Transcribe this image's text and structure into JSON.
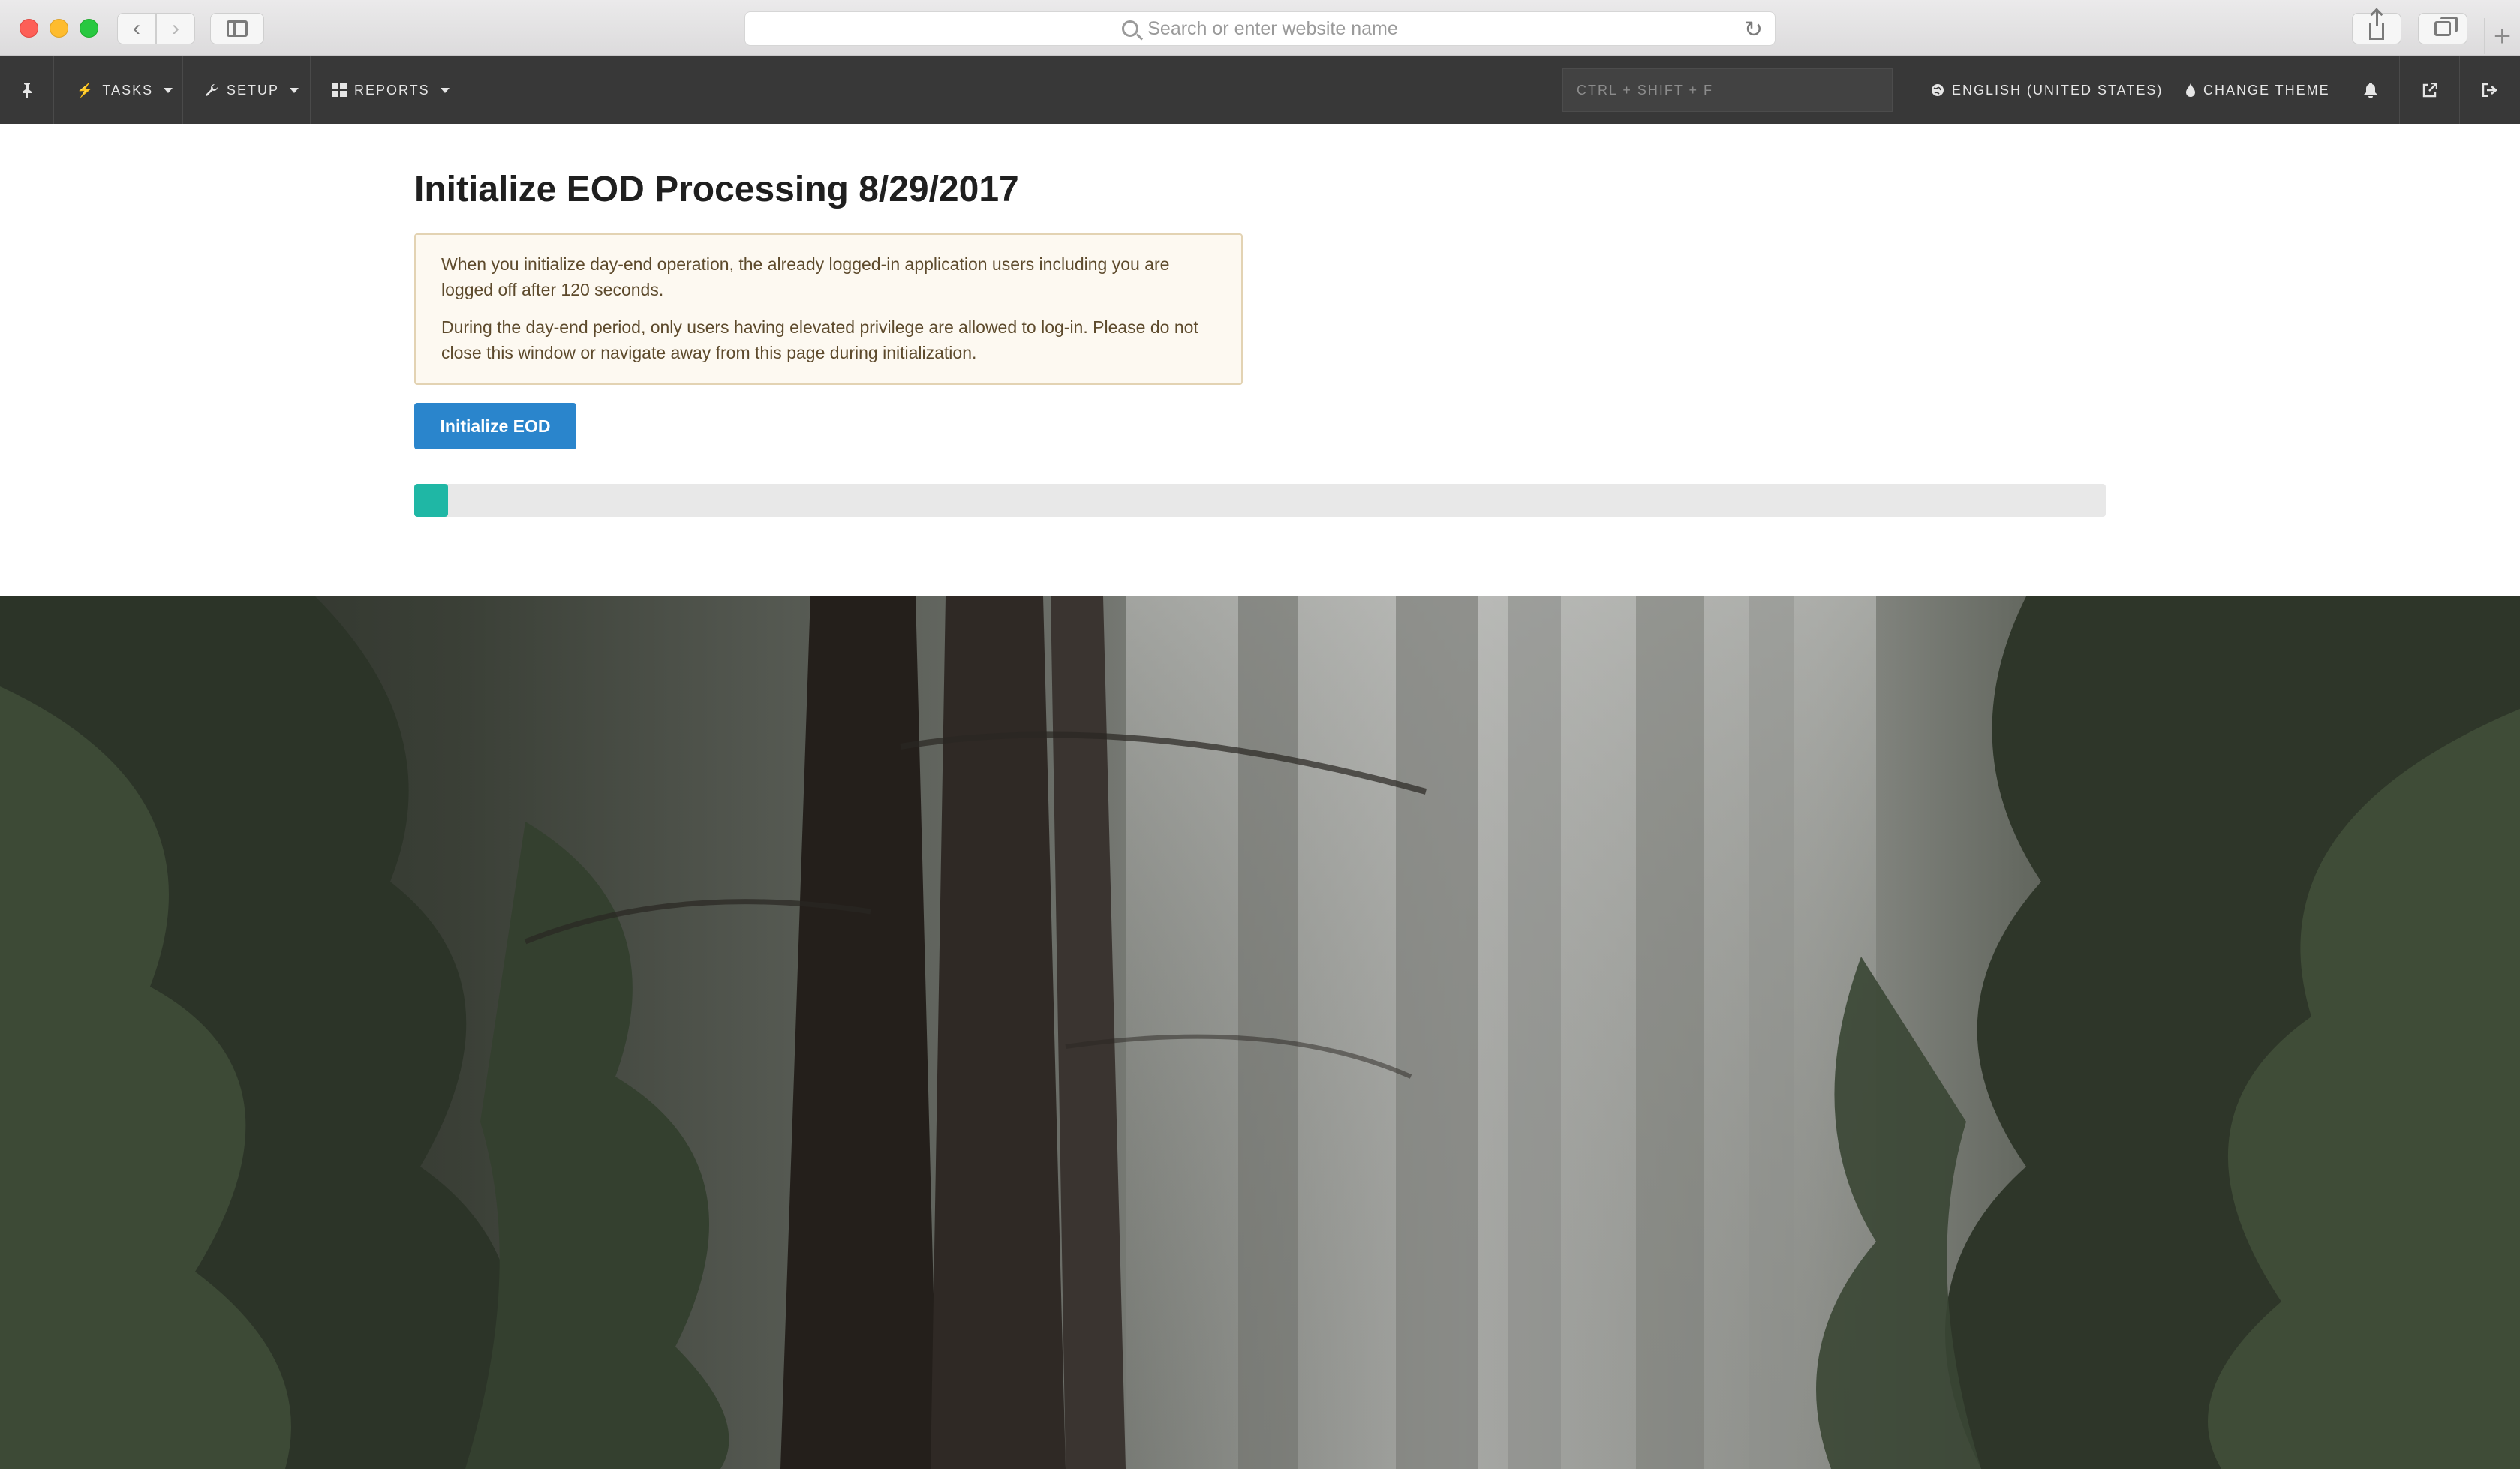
{
  "browser": {
    "url_placeholder": "Search or enter website name"
  },
  "nav": {
    "items": [
      {
        "id": "tasks",
        "label": "TASKS",
        "icon": "bolt-icon"
      },
      {
        "id": "setup",
        "label": "SETUP",
        "icon": "wrench-icon"
      },
      {
        "id": "reports",
        "label": "REPORTS",
        "icon": "grid-icon"
      }
    ],
    "search_placeholder": "CTRL + SHIFT + F",
    "language": "ENGLISH (UNITED STATES)",
    "theme": "CHANGE THEME"
  },
  "page": {
    "title": "Initialize EOD Processing 8/29/2017",
    "notice": {
      "paragraph1": "When you initialize day-end operation, the already logged-in application users including you are logged off after 120 seconds.",
      "paragraph2": "During the day-end period, only users having elevated privilege are allowed to log-in. Please do not close this window or navigate away from this page during initialization."
    },
    "button_label": "Initialize EOD",
    "progress_fraction": 0.02
  },
  "colors": {
    "accent": "#2a85cc",
    "progress": "#1fb7a5",
    "nav_bg": "#383838"
  }
}
